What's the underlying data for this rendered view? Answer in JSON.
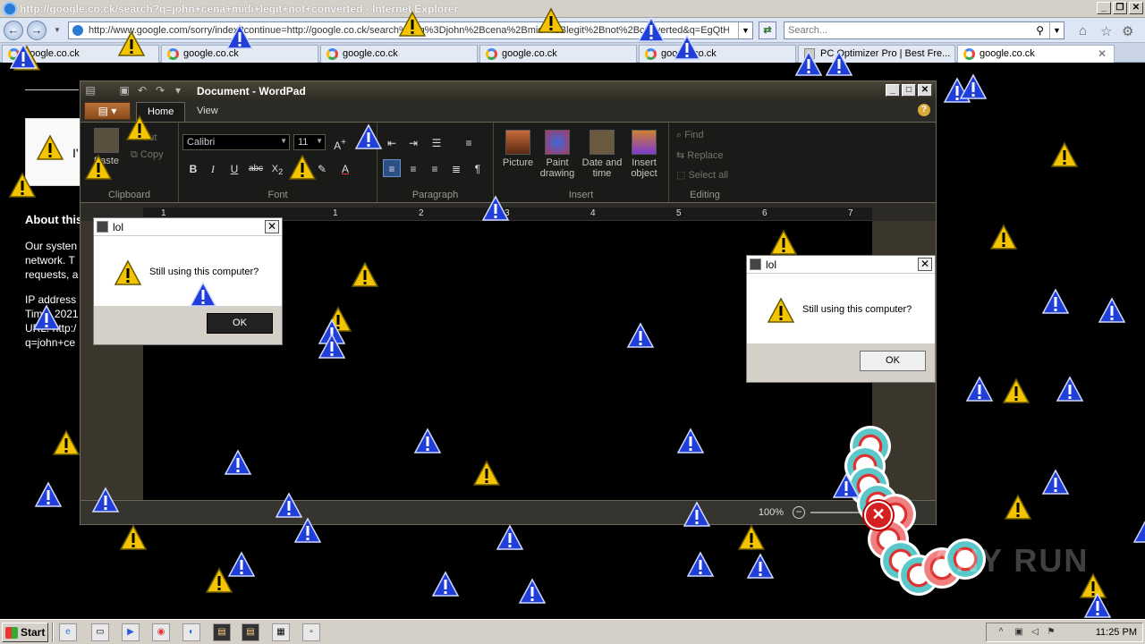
{
  "ie": {
    "title": "http://google.co.ck/search?q=john+cena+midi+legit+not+converted - Internet Explorer",
    "address": "http://www.google.com/sorry/index?continue=http://google.co.ck/search%3Fq%3Djohn%2Bcena%2Bmidi%2Blegit%2Bnot%2Bconverted&q=EgQtH",
    "search_placeholder": "Search...",
    "tabs": [
      {
        "label": "google.co.ck",
        "icon": "google-icon"
      },
      {
        "label": "google.co.ck",
        "icon": "google-icon"
      },
      {
        "label": "google.co.ck",
        "icon": "google-icon"
      },
      {
        "label": "google.co.ck",
        "icon": "google-icon"
      },
      {
        "label": "google.co.ck",
        "icon": "google-icon"
      },
      {
        "label": "PC Optimizer Pro | Best Fre...",
        "icon": "pc-optimizer-icon"
      },
      {
        "label": "google.co.ck",
        "icon": "google-icon",
        "active": true
      }
    ]
  },
  "sorry_page": {
    "captcha_text": "I'",
    "about_heading": "About this",
    "lines": [
      "Our systen",
      "network. T",
      "requests, a",
      "",
      "IP address",
      "Time: 2021",
      "URL: http:/",
      "q=john+ce"
    ]
  },
  "wordpad": {
    "title": "Document - WordPad",
    "tabs": {
      "home": "Home",
      "view": "View"
    },
    "clipboard": {
      "paste": "Paste",
      "cut": "Cut",
      "copy": "Copy",
      "label": "Clipboard"
    },
    "font": {
      "family": "Calibri",
      "size": "11",
      "label": "Font"
    },
    "paragraph": {
      "label": "Paragraph"
    },
    "insert": {
      "picture": "Picture",
      "paint1": "Paint",
      "paint2": "drawing",
      "date1": "Date and",
      "date2": "time",
      "obj1": "Insert",
      "obj2": "object",
      "label": "Insert"
    },
    "editing": {
      "find": "Find",
      "replace": "Replace",
      "select_all": "Select all",
      "label": "Editing"
    },
    "ruler": [
      "1",
      "1",
      "2",
      "3",
      "4",
      "5",
      "6",
      "7"
    ],
    "zoom": "100%"
  },
  "dialogs": [
    {
      "title": "lol",
      "message": "Still using this computer?",
      "ok": "OK"
    },
    {
      "title": "lol",
      "message": "Still using this computer?",
      "ok": "OK"
    }
  ],
  "taskbar": {
    "start": "Start",
    "clock": "11:25 PM"
  },
  "watermark": "ANY RUN",
  "colors": {
    "warning_yellow": "#f5c400",
    "warning_blue": "#1f3fd8",
    "error_red": "#d32020"
  }
}
